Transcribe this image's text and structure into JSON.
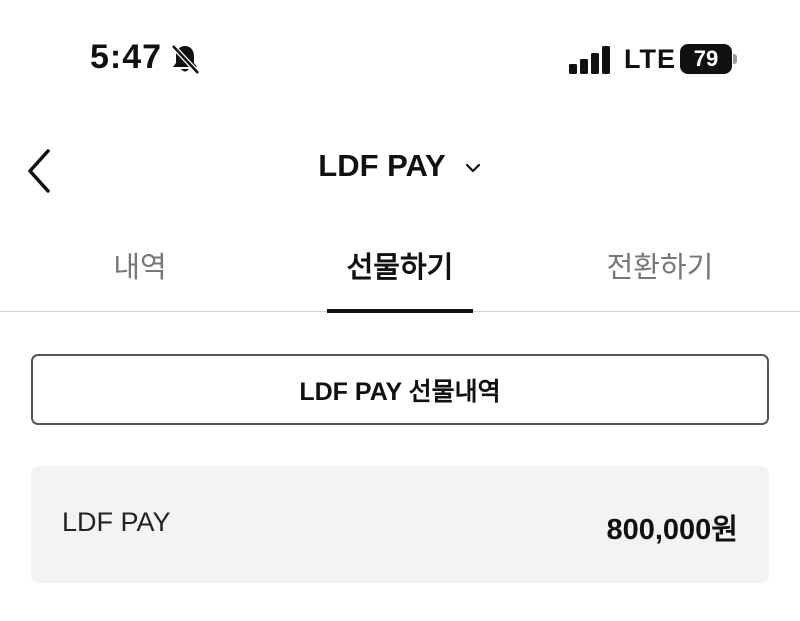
{
  "status_bar": {
    "time": "5:47",
    "network": "LTE",
    "battery_level": "79"
  },
  "header": {
    "title": "LDF PAY"
  },
  "tabs": [
    {
      "label": "내역",
      "active": false
    },
    {
      "label": "선물하기",
      "active": true
    },
    {
      "label": "전환하기",
      "active": false
    }
  ],
  "history_button": {
    "label": "LDF PAY 선물내역"
  },
  "balance": {
    "label": "LDF PAY",
    "value": "800,000원"
  },
  "icons": {
    "bell": "bell-slash-icon",
    "signal": "cellular-signal-icon",
    "battery": "battery-icon",
    "back": "chevron-left-icon",
    "dropdown": "chevron-down-icon"
  }
}
